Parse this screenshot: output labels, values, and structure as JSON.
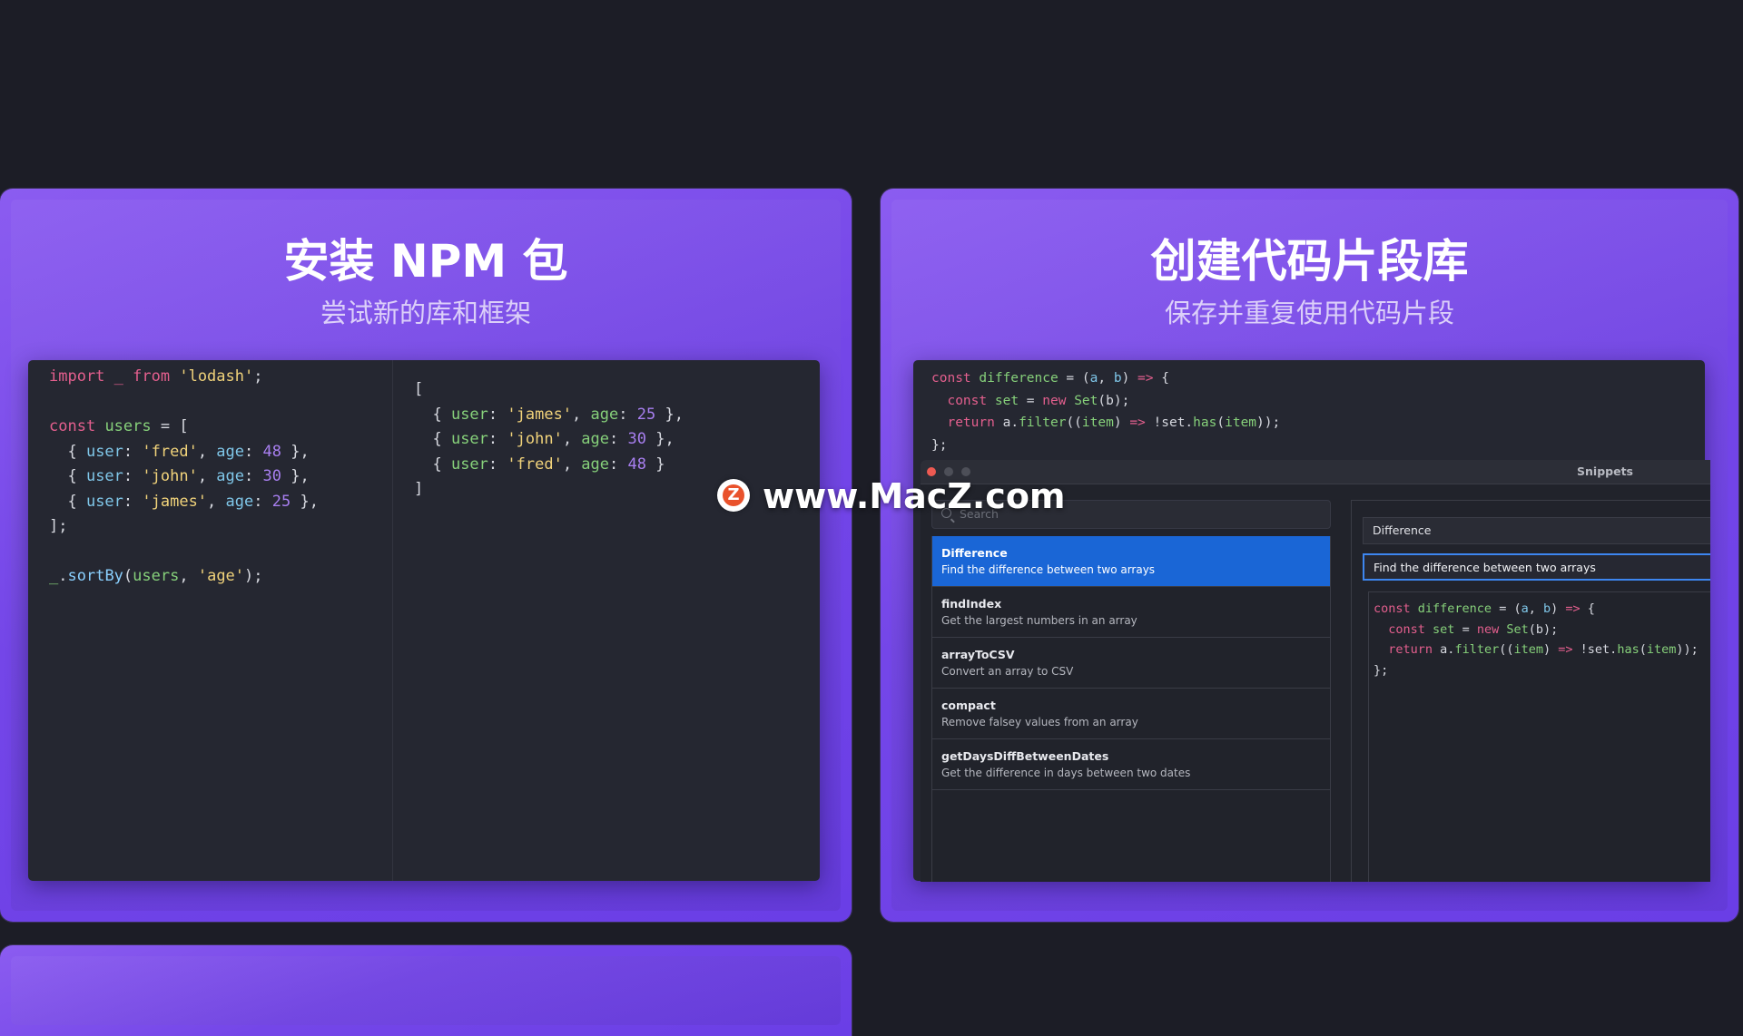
{
  "colors": {
    "card_purple": "#7446e8",
    "background": "#1c1d26",
    "editor_bg": "#252731",
    "selected_blue": "#1a66d6"
  },
  "card_left": {
    "title": "安装 NPM 包",
    "subtitle": "尝试新的库和框架",
    "editor_left_code": [
      [
        {
          "t": "import",
          "c": "kw"
        },
        {
          "t": " _ ",
          "c": "kw"
        },
        {
          "t": "from",
          "c": "kw"
        },
        {
          "t": " "
        },
        {
          "t": "'lodash'",
          "c": "str"
        },
        {
          "t": ";"
        }
      ],
      [],
      [
        {
          "t": "const",
          "c": "kw"
        },
        {
          "t": " "
        },
        {
          "t": "users",
          "c": "var"
        },
        {
          "t": " = ["
        }
      ],
      [
        {
          "t": "  { "
        },
        {
          "t": "user",
          "c": "prop"
        },
        {
          "t": ": "
        },
        {
          "t": "'fred'",
          "c": "str"
        },
        {
          "t": ", "
        },
        {
          "t": "age",
          "c": "prop"
        },
        {
          "t": ": "
        },
        {
          "t": "48",
          "c": "num"
        },
        {
          "t": " },"
        }
      ],
      [
        {
          "t": "  { "
        },
        {
          "t": "user",
          "c": "prop"
        },
        {
          "t": ": "
        },
        {
          "t": "'john'",
          "c": "str"
        },
        {
          "t": ", "
        },
        {
          "t": "age",
          "c": "prop"
        },
        {
          "t": ": "
        },
        {
          "t": "30",
          "c": "num"
        },
        {
          "t": " },"
        }
      ],
      [
        {
          "t": "  { "
        },
        {
          "t": "user",
          "c": "prop"
        },
        {
          "t": ": "
        },
        {
          "t": "'james'",
          "c": "str"
        },
        {
          "t": ", "
        },
        {
          "t": "age",
          "c": "prop"
        },
        {
          "t": ": "
        },
        {
          "t": "25",
          "c": "num"
        },
        {
          "t": " },"
        }
      ],
      [
        {
          "t": "];"
        }
      ],
      [],
      [
        {
          "t": "_",
          "c": "var"
        },
        {
          "t": "."
        },
        {
          "t": "sortBy",
          "c": "fn"
        },
        {
          "t": "("
        },
        {
          "t": "users",
          "c": "var"
        },
        {
          "t": ", "
        },
        {
          "t": "'age'",
          "c": "str"
        },
        {
          "t": ");"
        }
      ]
    ],
    "editor_right_code": [
      [
        {
          "t": "["
        }
      ],
      [
        {
          "t": "  { "
        },
        {
          "t": "user",
          "c": "var"
        },
        {
          "t": ": "
        },
        {
          "t": "'james'",
          "c": "str"
        },
        {
          "t": ", "
        },
        {
          "t": "age",
          "c": "var"
        },
        {
          "t": ": "
        },
        {
          "t": "25",
          "c": "num"
        },
        {
          "t": " },"
        }
      ],
      [
        {
          "t": "  { "
        },
        {
          "t": "user",
          "c": "var"
        },
        {
          "t": ": "
        },
        {
          "t": "'john'",
          "c": "str"
        },
        {
          "t": ", "
        },
        {
          "t": "age",
          "c": "var"
        },
        {
          "t": ": "
        },
        {
          "t": "30",
          "c": "num"
        },
        {
          "t": " },"
        }
      ],
      [
        {
          "t": "  { "
        },
        {
          "t": "user",
          "c": "var"
        },
        {
          "t": ": "
        },
        {
          "t": "'fred'",
          "c": "str"
        },
        {
          "t": ", "
        },
        {
          "t": "age",
          "c": "var"
        },
        {
          "t": ": "
        },
        {
          "t": "48",
          "c": "num"
        },
        {
          "t": " }"
        }
      ],
      [
        {
          "t": "]"
        }
      ]
    ]
  },
  "card_right": {
    "title": "创建代码片段库",
    "subtitle": "保存并重复使用代码片段",
    "editor_code": [
      [
        {
          "t": "const",
          "c": "kw"
        },
        {
          "t": " "
        },
        {
          "t": "difference",
          "c": "var"
        },
        {
          "t": " = ("
        },
        {
          "t": "a",
          "c": "prop"
        },
        {
          "t": ", "
        },
        {
          "t": "b",
          "c": "prop"
        },
        {
          "t": ") "
        },
        {
          "t": "=>",
          "c": "kw"
        },
        {
          "t": " {"
        }
      ],
      [
        {
          "t": "  "
        },
        {
          "t": "const",
          "c": "kw"
        },
        {
          "t": " "
        },
        {
          "t": "set",
          "c": "var"
        },
        {
          "t": " = "
        },
        {
          "t": "new",
          "c": "kw"
        },
        {
          "t": " "
        },
        {
          "t": "Set",
          "c": "var"
        },
        {
          "t": "(b);"
        }
      ],
      [
        {
          "t": "  "
        },
        {
          "t": "return",
          "c": "kw"
        },
        {
          "t": " a."
        },
        {
          "t": "filter",
          "c": "var"
        },
        {
          "t": "(("
        },
        {
          "t": "item",
          "c": "var"
        },
        {
          "t": ") "
        },
        {
          "t": "=>",
          "c": "kw"
        },
        {
          "t": " !set."
        },
        {
          "t": "has",
          "c": "var"
        },
        {
          "t": "("
        },
        {
          "t": "item",
          "c": "var"
        },
        {
          "t": "));"
        }
      ],
      [
        {
          "t": "};"
        }
      ]
    ]
  },
  "snippets": {
    "window_title": "Snippets",
    "search_placeholder": "Search",
    "items": [
      {
        "name": "Difference",
        "desc": "Find the difference between two arrays",
        "selected": true
      },
      {
        "name": "findIndex",
        "desc": "Get the largest numbers in an array",
        "selected": false
      },
      {
        "name": "arrayToCSV",
        "desc": "Convert an array to CSV",
        "selected": false
      },
      {
        "name": "compact",
        "desc": "Remove falsey values from an array",
        "selected": false
      },
      {
        "name": "getDaysDiffBetweenDates",
        "desc": "Get the difference in days between two dates",
        "selected": false
      }
    ],
    "detail_name": "Difference",
    "detail_desc": "Find the difference between two arrays",
    "detail_code": [
      [
        {
          "t": "const",
          "c": "kw"
        },
        {
          "t": " "
        },
        {
          "t": "difference",
          "c": "var"
        },
        {
          "t": " = ("
        },
        {
          "t": "a",
          "c": "prop"
        },
        {
          "t": ", "
        },
        {
          "t": "b",
          "c": "prop"
        },
        {
          "t": ") "
        },
        {
          "t": "=>",
          "c": "kw"
        },
        {
          "t": " {"
        }
      ],
      [
        {
          "t": "  "
        },
        {
          "t": "const",
          "c": "kw"
        },
        {
          "t": " "
        },
        {
          "t": "set",
          "c": "var"
        },
        {
          "t": " = "
        },
        {
          "t": "new",
          "c": "kw"
        },
        {
          "t": " "
        },
        {
          "t": "Set",
          "c": "var"
        },
        {
          "t": "(b);"
        }
      ],
      [
        {
          "t": "  "
        },
        {
          "t": "return",
          "c": "kw"
        },
        {
          "t": " a."
        },
        {
          "t": "filter",
          "c": "var"
        },
        {
          "t": "(("
        },
        {
          "t": "item",
          "c": "var"
        },
        {
          "t": ") "
        },
        {
          "t": "=>",
          "c": "kw"
        },
        {
          "t": " !set."
        },
        {
          "t": "has",
          "c": "var"
        },
        {
          "t": "("
        },
        {
          "t": "item",
          "c": "var"
        },
        {
          "t": "));"
        }
      ],
      [
        {
          "t": "};"
        }
      ]
    ]
  },
  "watermark": {
    "logo_letter": "Z",
    "text": "www.MacZ.com"
  }
}
